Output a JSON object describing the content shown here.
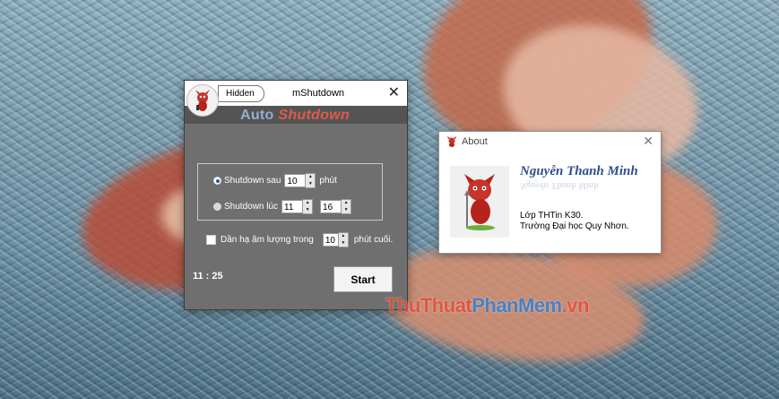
{
  "main_window": {
    "hidden_label": "Hidden",
    "title": "mShutdown",
    "close_label": "✕",
    "logo": {
      "word1": "Auto",
      "word2": "Shutdown"
    },
    "shutdown_after": {
      "label": "Shutdown sau",
      "value": "10",
      "unit": "phút",
      "selected": true
    },
    "shutdown_at": {
      "label": "Shutdown lúc",
      "hour": "11",
      "minute": "16",
      "selected": false
    },
    "lower_volume": {
      "label": "Dần hạ âm lượng trong",
      "value": "10",
      "suffix": "phút cuối.",
      "checked": false
    },
    "clock": "11 : 25",
    "start_label": "Start"
  },
  "about_window": {
    "title": "About",
    "close_label": "✕",
    "author": "Nguyễn Thanh Minh",
    "class_line": "Lớp THTin K30.",
    "school_line": "Trường Đại học Quy Nhơn."
  },
  "watermark": {
    "part1": "ThuThuat",
    "part2": "PhanMem",
    "part3": ".vn"
  },
  "colors": {
    "main_bg": "#6f6f6f",
    "logo_blue": "#8fb0d0",
    "logo_red": "#e05a4a",
    "author_blue": "#2d4f8a"
  },
  "icons": {
    "app": "devil-mascot-icon",
    "about": "devil-mascot-icon",
    "close": "close-icon",
    "spin": "spin-arrows-icon"
  }
}
